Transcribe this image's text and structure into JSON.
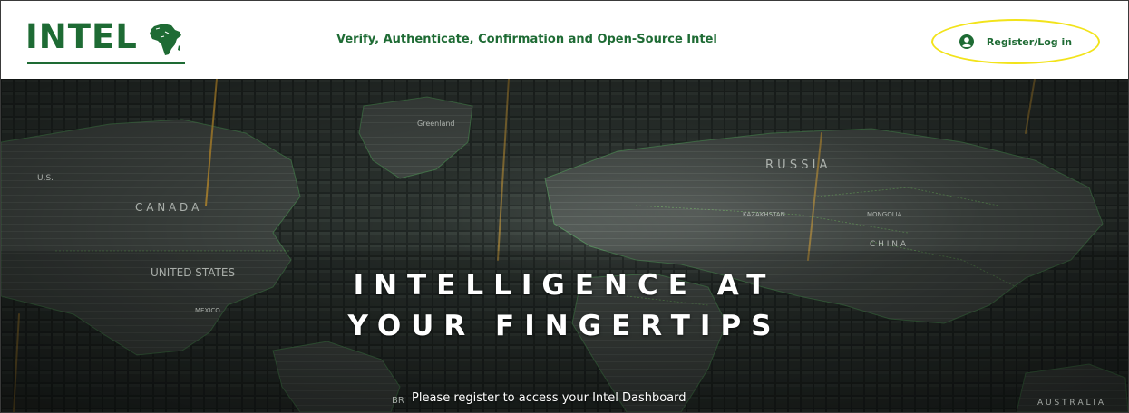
{
  "header": {
    "logo_text": "INTEL",
    "tagline": "Verify, Authenticate, Confirmation and Open-Source Intel",
    "login_label": "Register/Log in",
    "login_icon": "user-circle-icon"
  },
  "hero": {
    "title_line1": "INTELLIGENCE AT",
    "title_line2": "YOUR FINGERTIPS",
    "subtitle": "Please register to access your Intel Dashboard",
    "map_labels": {
      "greenland": "Greenland",
      "us": "U.S.",
      "canada": "C A N A D A",
      "united_states": "UNITED STATES",
      "mexico": "MEXICO",
      "russia": "R U S S I A",
      "kazakhstan": "KAZAKHSTAN",
      "mongolia": "MONGOLIA",
      "china": "C H I N A",
      "australia": "A U S T R A L I A",
      "br": "BR"
    }
  },
  "colors": {
    "brand_green": "#1e6b34",
    "highlight_yellow": "#f2e31a",
    "hero_dark": "#1c2320",
    "map_green": "#3fa34d"
  }
}
